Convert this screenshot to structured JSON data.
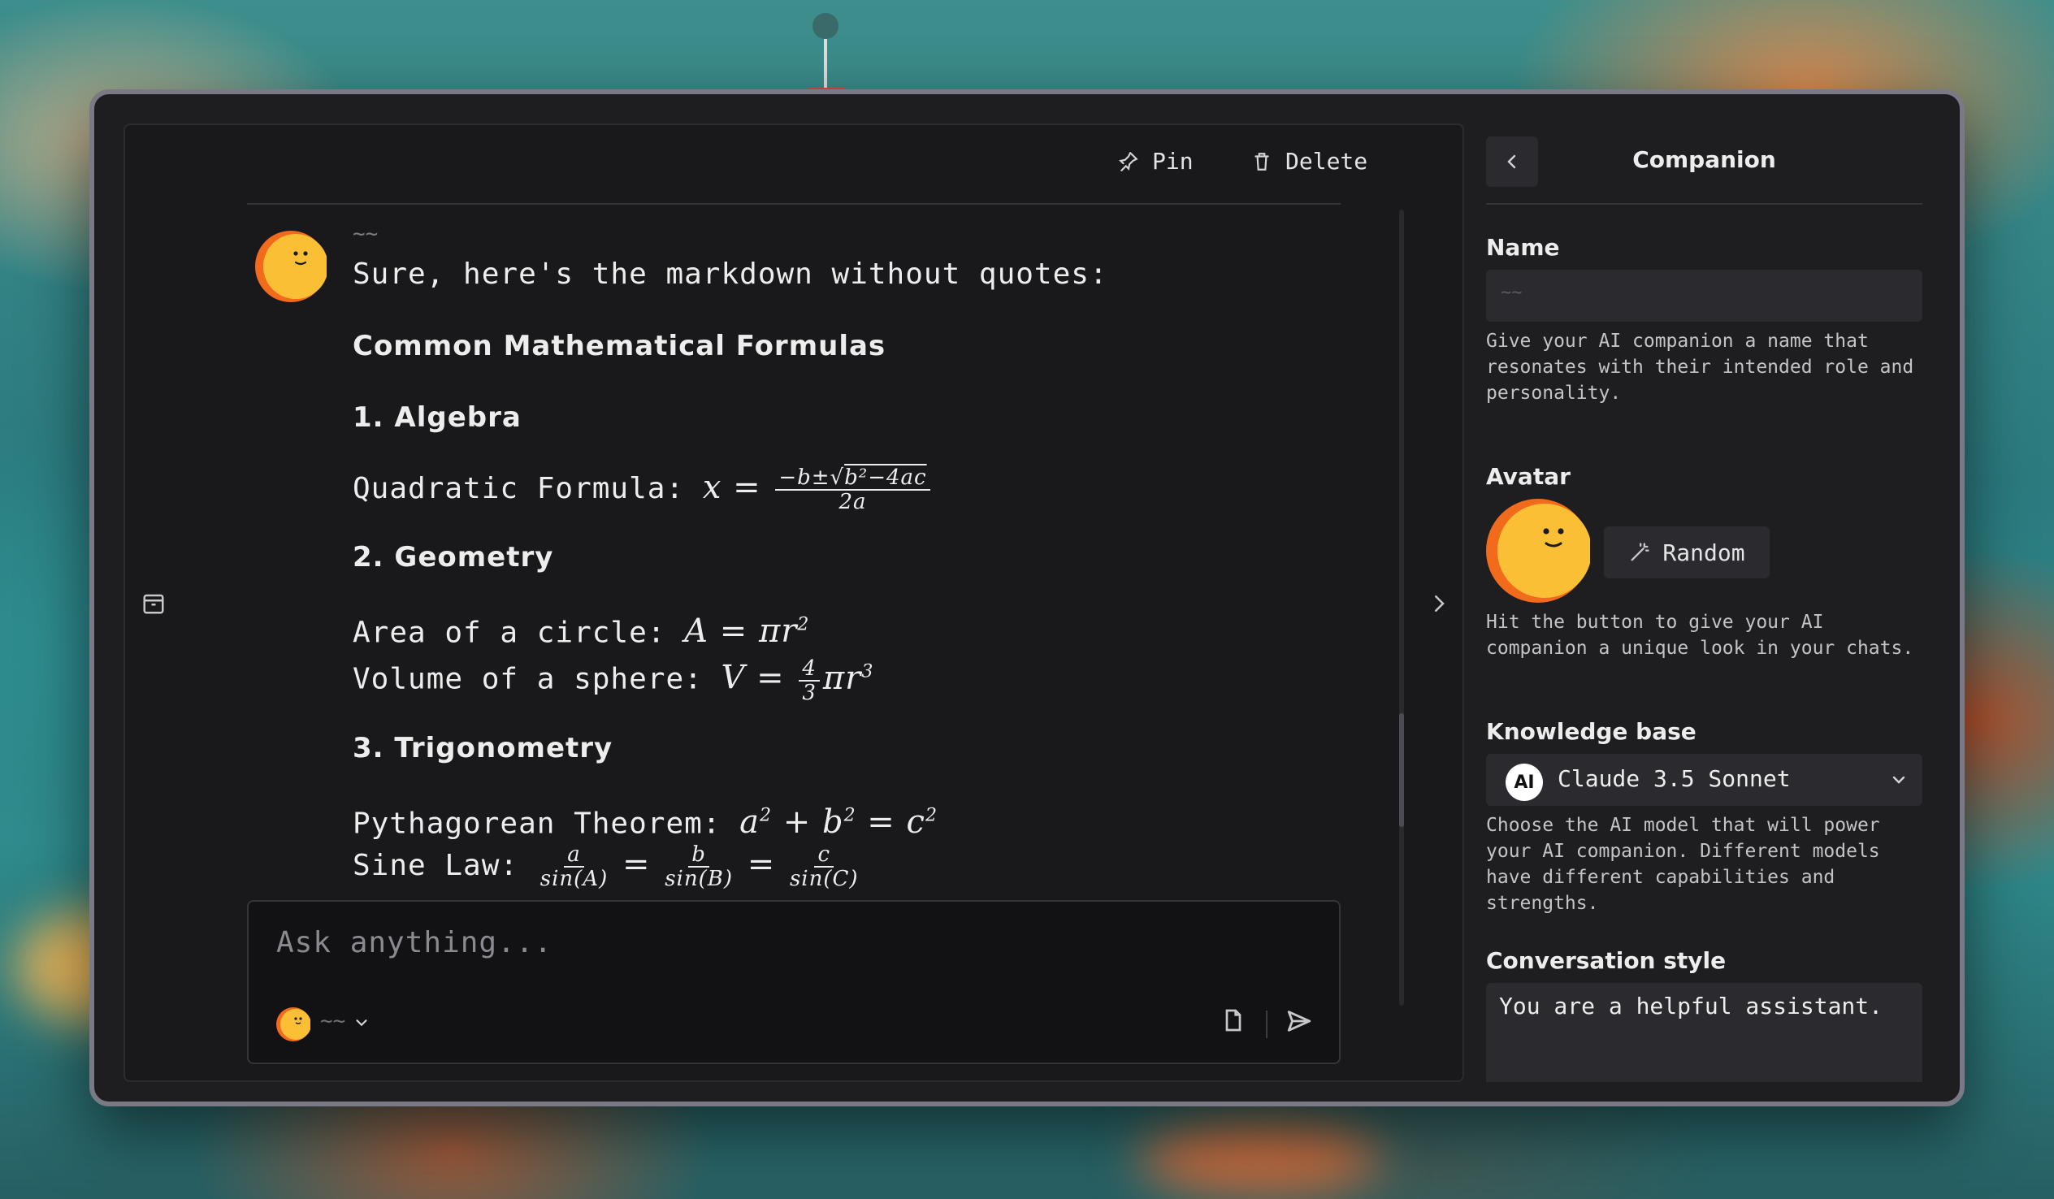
{
  "chat": {
    "toolbar": {
      "pin_label": "Pin",
      "delete_label": "Delete"
    },
    "message": {
      "author_name": "~~",
      "intro": "Sure, here's the markdown without quotes:",
      "title": "Common Mathematical Formulas",
      "sections": [
        {
          "heading": "1. Algebra",
          "lines": [
            {
              "label": "Quadratic Formula:",
              "formula": "x = (−b±√(b²−4ac)) / 2a"
            }
          ]
        },
        {
          "heading": "2. Geometry",
          "lines": [
            {
              "label": "Area of a circle:",
              "formula": "A = πr²"
            },
            {
              "label": "Volume of a sphere:",
              "formula": "V = 4/3 πr³"
            }
          ]
        },
        {
          "heading": "3. Trigonometry",
          "lines": [
            {
              "label": "Pythagorean Theorem:",
              "formula": "a² + b² = c²"
            },
            {
              "label": "Sine Law:",
              "formula": "a/sin(A) = b/sin(B) = c/sin(C)"
            }
          ]
        }
      ]
    },
    "composer": {
      "placeholder": "Ask anything...",
      "model_name": "~~"
    }
  },
  "sidebar": {
    "title": "Companion",
    "name": {
      "label": "Name",
      "value": "~~",
      "help": "Give your AI companion a name that resonates with their intended role and personality."
    },
    "avatar": {
      "label": "Avatar",
      "random_label": "Random",
      "help": "Hit the button to give your AI companion a unique look in your chats."
    },
    "knowledge_base": {
      "label": "Knowledge base",
      "selected": "Claude 3.5 Sonnet",
      "icon_text": "AI",
      "help": "Choose the AI model that will power your AI companion. Different models have different capabilities and strengths."
    },
    "conversation_style": {
      "label": "Conversation style",
      "value": "You are a helpful assistant."
    }
  },
  "colors": {
    "accent_avatar": "#fbbf35",
    "avatar_shadow": "#f26b1d",
    "panel": "#19191b",
    "window": "#1e1e21"
  }
}
